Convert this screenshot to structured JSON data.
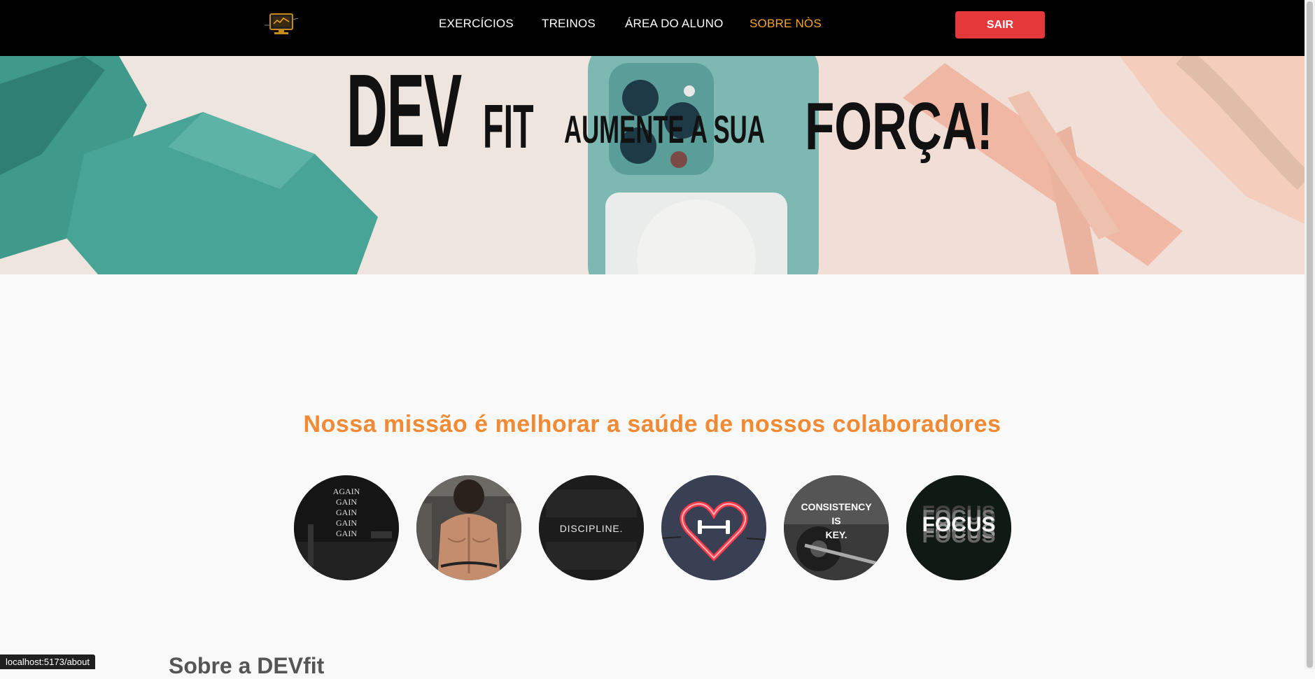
{
  "nav": {
    "logo_icon": "monitor-logo-icon",
    "links": [
      {
        "label": "EXERCÍCIOS"
      },
      {
        "label": "TREINOS"
      },
      {
        "label": "ÁREA DO ALUNO"
      },
      {
        "label": "SOBRE NÒS"
      }
    ],
    "logout_label": "SAIR",
    "active_color": "#f5a623",
    "logout_color": "#e5383b"
  },
  "hero": {
    "brand_dev": "DEV",
    "brand_fit": "FIT",
    "tagline": "AUMENTE A SUA",
    "emphasis": "FORÇA!"
  },
  "mission": {
    "heading": "Nossa missão é melhorar a saúde de nossos colaboradores",
    "color": "#f08a34"
  },
  "circles": [
    {
      "name": "gain-image",
      "text": "AGAIN\nGAIN\nGAIN\nGAIN\nGAIN"
    },
    {
      "name": "athlete-back-image",
      "text": ""
    },
    {
      "name": "discipline-image",
      "text": "DISCIPLINE."
    },
    {
      "name": "neon-heart-dumbbell-image",
      "text": ""
    },
    {
      "name": "consistency-image",
      "text": "CONSISTENCY\nIS\nKEY."
    },
    {
      "name": "focus-image",
      "text": "FOCUS"
    }
  ],
  "about": {
    "title": "Sobre a DEVfit"
  },
  "status_bar": {
    "url": "localhost:5173/about"
  }
}
